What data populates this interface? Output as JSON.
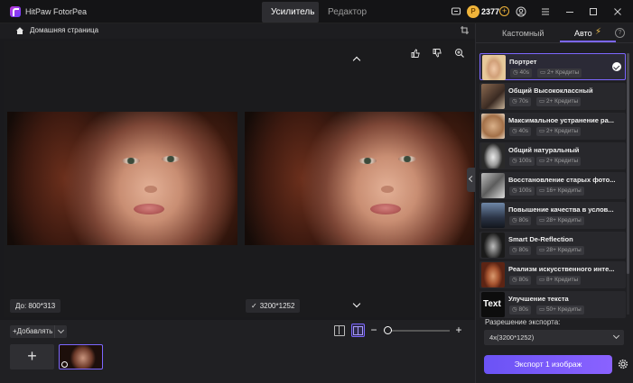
{
  "titlebar": {
    "app_name": "HitPaw FotorPea",
    "tabs": [
      {
        "label": "Усилитель",
        "active": true
      },
      {
        "label": "Редактор",
        "active": false
      }
    ],
    "credits": "2377"
  },
  "breadcrumb": {
    "home_label": "Домашняя страница"
  },
  "canvas": {
    "before_size": "До: 800*313",
    "after_size": "3200*1252"
  },
  "bottom": {
    "add_label": "Добавлять",
    "add_thumb": "+"
  },
  "panel": {
    "tabs": [
      {
        "label": "Кастомный",
        "active": false
      },
      {
        "label": "Авто",
        "active": true
      }
    ],
    "presets": [
      {
        "name": "Портрет",
        "time": "40s",
        "cost": "2+ Кредиты",
        "selected": true,
        "thumb": "portrait"
      },
      {
        "name": "Общий Высококлассный",
        "time": "70s",
        "cost": "2+ Кредиты",
        "selected": false,
        "thumb": "cat"
      },
      {
        "name": "Максимальное устранение ра...",
        "time": "40s",
        "cost": "2+ Кредиты",
        "selected": false,
        "thumb": "cat2"
      },
      {
        "name": "Общий натуральный",
        "time": "100s",
        "cost": "2+ Кредиты",
        "selected": false,
        "thumb": "bw-portrait"
      },
      {
        "name": "Восстановление старых фото...",
        "time": "100s",
        "cost": "16+ Кредиты",
        "selected": false,
        "thumb": "old-photo"
      },
      {
        "name": "Повышение качества в услов...",
        "time": "80s",
        "cost": "28+ Кредиты",
        "selected": false,
        "thumb": "night"
      },
      {
        "name": "Smart De-Reflection",
        "time": "80s",
        "cost": "28+ Кредиты",
        "selected": false,
        "thumb": "reflection"
      },
      {
        "name": "Реализм искусственного инте...",
        "time": "80s",
        "cost": "8+ Кредиты",
        "selected": false,
        "thumb": "ai"
      },
      {
        "name": "Улучшение текста",
        "time": "80s",
        "cost": "50+ Кредиты",
        "selected": false,
        "thumb": "text",
        "thumb_text": "Text"
      }
    ],
    "export_label": "Разрешение экспорта:",
    "export_value": "4x(3200*1252)",
    "export_button": "Экспорт 1 изображ"
  },
  "colors": {
    "accent": "#7c67ff",
    "coin": "#f0b43a",
    "background": "#1a1a1d"
  }
}
